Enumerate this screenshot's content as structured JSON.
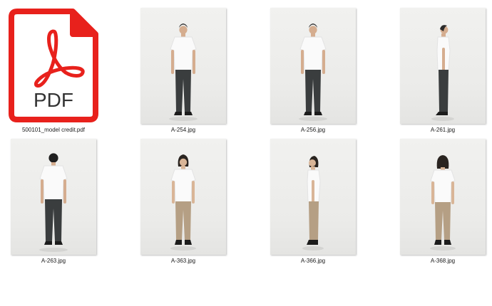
{
  "files": [
    {
      "name": "500101_model credit.pdf",
      "kind": "pdf",
      "icon": "pdf-file-icon",
      "badge": "PDF",
      "accent": "#e8211c"
    },
    {
      "name": "A-254.jpg",
      "kind": "photo",
      "icon": "photo-thumbnail",
      "subject": "man front view",
      "shirt": "#fafafa",
      "pants": "#3a3d3e"
    },
    {
      "name": "A-256.jpg",
      "kind": "photo",
      "icon": "photo-thumbnail",
      "subject": "man front view",
      "shirt": "#fafafa",
      "pants": "#3a3d3e"
    },
    {
      "name": "A-261.jpg",
      "kind": "photo",
      "icon": "photo-thumbnail",
      "subject": "man side view",
      "shirt": "#fafafa",
      "pants": "#3a3d3e"
    },
    {
      "name": "A-263.jpg",
      "kind": "photo",
      "icon": "photo-thumbnail",
      "subject": "man back view",
      "shirt": "#fafafa",
      "pants": "#3a3d3e"
    },
    {
      "name": "A-363.jpg",
      "kind": "photo",
      "icon": "photo-thumbnail",
      "subject": "woman front view",
      "shirt": "#fafafa",
      "pants": "#b59f84"
    },
    {
      "name": "A-366.jpg",
      "kind": "photo",
      "icon": "photo-thumbnail",
      "subject": "woman side view",
      "shirt": "#fafafa",
      "pants": "#b59f84"
    },
    {
      "name": "A-368.jpg",
      "kind": "photo",
      "icon": "photo-thumbnail",
      "subject": "woman back view",
      "shirt": "#fafafa",
      "pants": "#b59f84"
    }
  ]
}
